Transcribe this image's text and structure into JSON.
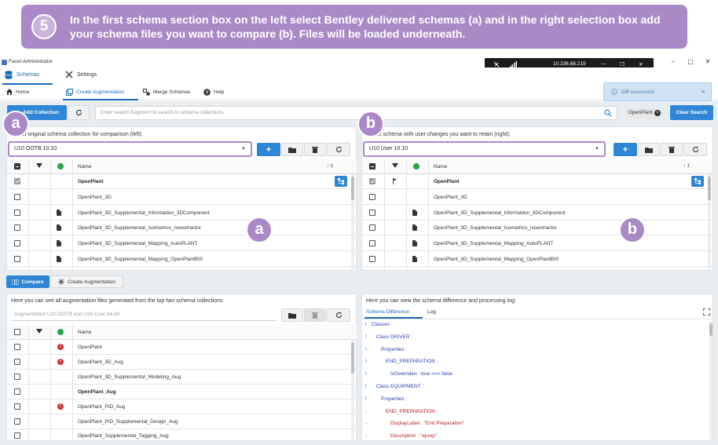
{
  "banner": {
    "step": "5",
    "text": "In the first schema section box on the left select Bentley delivered schemas (a) and in the right selection box add your schema files you want to compare (b). Files will be loaded underneath."
  },
  "window": {
    "title": "Facet Administrator",
    "controls": [
      "–",
      "▢",
      "✕"
    ]
  },
  "remote": {
    "ip": "10.236.68.219",
    "controls": [
      "—",
      "❐",
      "✕"
    ]
  },
  "menu": {
    "schemas": "Schemas",
    "settings": "Settings"
  },
  "subnav": {
    "home": "Home",
    "create_augmentation": "Create Augmentation",
    "merge_schemas": "Merge Schemas",
    "help": "Help"
  },
  "toast": {
    "text": "Diff successful",
    "close": "✕"
  },
  "search": {
    "add_collection": "Add Collection",
    "placeholder": "Enter search fragment to search in schema collections",
    "chip": "OpenPlant",
    "clear_search": "Clear Search"
  },
  "markers": {
    "a": "a",
    "b": "b"
  },
  "left_panel": {
    "label": "Select original schema collection for comparison (left):",
    "selected": "U10 OOTB 10.10",
    "name_header": "Name",
    "sort_indicator": "↑ 1",
    "rows": [
      {
        "name": "OpenPlant",
        "bold": true,
        "doc": false,
        "checked": true
      },
      {
        "name": "OpenPlant_3D",
        "bold": false,
        "doc": false,
        "checked": false
      },
      {
        "name": "OpenPlant_3D_Supplemental_Information_3DComponent",
        "bold": false,
        "doc": true,
        "checked": false
      },
      {
        "name": "OpenPlant_3D_Supplemental_Isometrics_Isoextractor",
        "bold": false,
        "doc": true,
        "checked": false
      },
      {
        "name": "OpenPlant_3D_Supplemental_Mapping_AutoPLANT",
        "bold": false,
        "doc": true,
        "checked": false
      },
      {
        "name": "OpenPlant_3D_Supplemental_Mapping_OpenPlantBIS",
        "bold": false,
        "doc": true,
        "checked": false
      }
    ]
  },
  "right_panel": {
    "label": "Select schema with user changes you want to retain (right):",
    "selected": "U10 User 10.10",
    "name_header": "Name",
    "sort_indicator": "↑ 1",
    "rows": [
      {
        "name": "OpenPlant",
        "bold": true,
        "doc": false,
        "checked": true
      },
      {
        "name": "OpenPlant_3D",
        "bold": false,
        "doc": false,
        "checked": false
      },
      {
        "name": "OpenPlant_3D_Supplemental_Information_3DComponent",
        "bold": false,
        "doc": true,
        "checked": false
      },
      {
        "name": "OpenPlant_3D_Supplemental_Isometrics_Isoextractor",
        "bold": false,
        "doc": true,
        "checked": false
      },
      {
        "name": "OpenPlant_3D_Supplemental_Mapping_AutoPLANT",
        "bold": false,
        "doc": true,
        "checked": false
      },
      {
        "name": "OpenPlant_3D_Supplemental_Mapping_OpenPlantBIS",
        "bold": false,
        "doc": true,
        "checked": false
      }
    ]
  },
  "bottom_tabs": {
    "compare": "Compare",
    "create_augmentation": "Create Augmentation"
  },
  "aug_panel": {
    "label": "Here you can see all augmentation files generated from the top two schema collections:",
    "input_value": "Augmentation U10 OOTB and U10 User 24.00",
    "name_header": "Name",
    "rows": [
      {
        "name": "OpenPlant",
        "bold": false,
        "error": true
      },
      {
        "name": "OpenPlant_3D_Aug",
        "bold": false,
        "error": true
      },
      {
        "name": "OpenPlant_3D_Supplemental_Modeling_Aug",
        "bold": false,
        "error": false
      },
      {
        "name": "OpenPlant_Aug",
        "bold": true,
        "error": false
      },
      {
        "name": "OpenPlant_PID_Aug",
        "bold": false,
        "error": true
      },
      {
        "name": "OpenPlant_PID_Supplemental_Design_Aug",
        "bold": false,
        "error": false
      },
      {
        "name": "OpenPlant_Supplemental_Tagging_Aug",
        "bold": false,
        "error": false
      }
    ]
  },
  "diff_panel": {
    "label": "Here you can view the schema difference and processing log:",
    "tab_diff": "Schema Difference",
    "tab_log": "Log",
    "lines": [
      {
        "prefix": "!",
        "text": "Classes :",
        "indent": 0,
        "color": "#2c3fb0"
      },
      {
        "prefix": "!",
        "text": "Class DRIVER :",
        "indent": 1,
        "color": "#2c3fb0"
      },
      {
        "prefix": "!",
        "text": "Properties :",
        "indent": 2,
        "color": "#2c3fb0"
      },
      {
        "prefix": "!",
        "text": "END_PREPARATION :",
        "indent": 3,
        "color": "#2c3fb0"
      },
      {
        "prefix": "!",
        "text": "IsOverriden : true <=> false",
        "indent": 4,
        "color": "#2c3fb0"
      },
      {
        "prefix": "!",
        "text": "Class EQUIPMENT :",
        "indent": 1,
        "color": "#2c3fb0"
      },
      {
        "prefix": "!",
        "text": "Properties :",
        "indent": 2,
        "color": "#2c3fb0"
      },
      {
        "prefix": "-",
        "text": "END_PREPARATION :",
        "indent": 3,
        "color": "#b0262c"
      },
      {
        "prefix": "-",
        "text": "DisplayLabel : \"End Preparation\"",
        "indent": 4,
        "color": "#b0262c"
      },
      {
        "prefix": "-",
        "text": "Description : \"eprep\"",
        "indent": 4,
        "color": "#b0262c"
      }
    ]
  },
  "colors": {
    "accent": "#2f86d6",
    "highlight": "#a98ac7",
    "error": "#d22f2f",
    "ok": "#23a84b"
  }
}
